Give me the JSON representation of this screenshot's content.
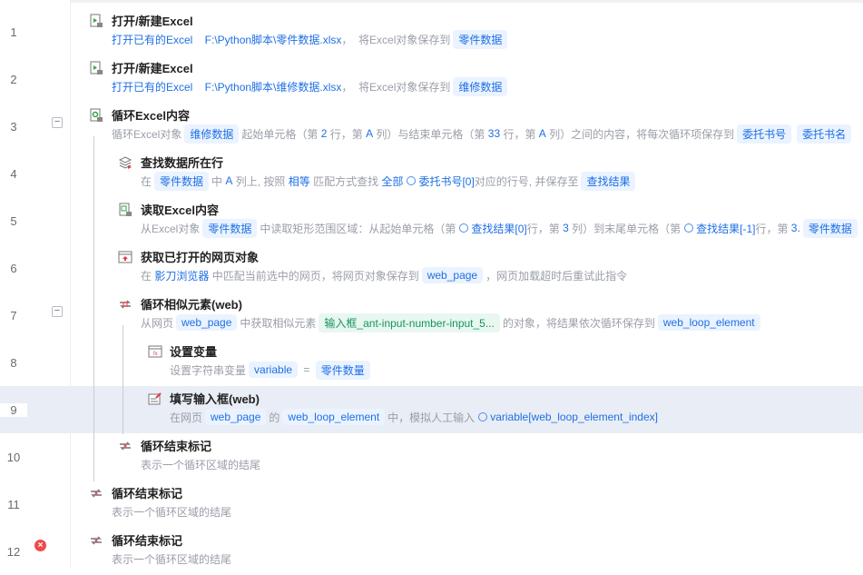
{
  "steps": [
    {
      "num": "1",
      "level": 0,
      "icon": "excel-open-icon",
      "title": "打开/新建Excel",
      "desc": [
        [
          "v",
          "打开已有的Excel    F:\\Python脚本\\零件数据.xlsx"
        ],
        [
          "t",
          "，  将Excel对象保存到"
        ],
        [
          "chip",
          "零件数据"
        ]
      ]
    },
    {
      "num": "2",
      "level": 0,
      "icon": "excel-open-icon",
      "title": "打开/新建Excel",
      "desc": [
        [
          "v",
          "打开已有的Excel    F:\\Python脚本\\维修数据.xlsx"
        ],
        [
          "t",
          "，  将Excel对象保存到"
        ],
        [
          "chip",
          "维修数据"
        ]
      ]
    },
    {
      "num": "3",
      "level": 0,
      "icon": "excel-loop-icon",
      "collapse": "−",
      "title": "循环Excel内容",
      "desc": [
        [
          "t",
          "循环Excel对象"
        ],
        [
          "chip",
          "维修数据"
        ],
        [
          "t",
          "起始单元格（第 "
        ],
        [
          "v",
          "2"
        ],
        [
          "t",
          " 行，第 "
        ],
        [
          "v",
          "A"
        ],
        [
          "t",
          " 列）与结束单元格（第 "
        ],
        [
          "v",
          "33"
        ],
        [
          "t",
          " 行，第 "
        ],
        [
          "v",
          "A"
        ],
        [
          "t",
          " 列）之间的内容，将每次循环项保存到"
        ],
        [
          "chip",
          "委托书号"
        ],
        [
          "chip",
          "委托书名"
        ]
      ]
    },
    {
      "num": "4",
      "level": 1,
      "icon": "find-row-icon",
      "title": "查找数据所在行",
      "desc": [
        [
          "t",
          "在"
        ],
        [
          "chip",
          "零件数据"
        ],
        [
          "t",
          "中 "
        ],
        [
          "v",
          "A"
        ],
        [
          "t",
          " 列上, 按照 "
        ],
        [
          "v",
          "相等"
        ],
        [
          "t",
          " 匹配方式查找 "
        ],
        [
          "v",
          "全部"
        ],
        [
          "vi",
          ""
        ],
        [
          "v",
          "委托书号[0]"
        ],
        [
          "t",
          "对应的行号, 并保存至"
        ],
        [
          "chip",
          "查找结果"
        ]
      ]
    },
    {
      "num": "5",
      "level": 1,
      "icon": "excel-read-icon",
      "title": "读取Excel内容",
      "desc": [
        [
          "t",
          "从Excel对象"
        ],
        [
          "chip",
          "零件数据"
        ],
        [
          "t",
          "中读取矩形范围区域：从起始单元格（第"
        ],
        [
          "vi",
          ""
        ],
        [
          "v",
          "查找结果[0]"
        ],
        [
          "t",
          "行，第 "
        ],
        [
          "v",
          "3"
        ],
        [
          "t",
          " 列）到末尾单元格（第"
        ],
        [
          "vi",
          ""
        ],
        [
          "v",
          "查找结果[-1]"
        ],
        [
          "t",
          "行，第 "
        ],
        [
          "v",
          "3."
        ],
        [
          "chip",
          "零件数据"
        ]
      ]
    },
    {
      "num": "6",
      "level": 1,
      "icon": "browser-page-icon",
      "title": "获取已打开的网页对象",
      "desc": [
        [
          "t",
          "在 "
        ],
        [
          "v",
          "影刀浏览器"
        ],
        [
          "t",
          " 中匹配当前选中的网页，将网页对象保存到"
        ],
        [
          "chip",
          "web_page"
        ],
        [
          "t",
          "，网页加载超时后重试此指令"
        ]
      ]
    },
    {
      "num": "7",
      "level": 1,
      "icon": "loop-icon",
      "collapse": "−",
      "title": "循环相似元素(web)",
      "desc": [
        [
          "t",
          "从网页"
        ],
        [
          "chip",
          "web_page"
        ],
        [
          "t",
          "中获取相似元素"
        ],
        [
          "chipg",
          "输入框_ant-input-number-input_5..."
        ],
        [
          "t",
          "的对象，将结果依次循环保存到"
        ],
        [
          "chip",
          "web_loop_element"
        ]
      ]
    },
    {
      "num": "8",
      "level": 2,
      "icon": "set-variable-icon",
      "title": "设置变量",
      "desc": [
        [
          "t",
          "设置字符串变量"
        ],
        [
          "chip",
          "variable"
        ],
        [
          "t",
          " = "
        ],
        [
          "chip",
          "零件数量"
        ]
      ]
    },
    {
      "num": "9",
      "level": 2,
      "icon": "fill-input-icon",
      "selected": true,
      "title": "填写输入框(web)",
      "desc": [
        [
          "t",
          "在网页"
        ],
        [
          "chip",
          "web_page"
        ],
        [
          "t",
          "的"
        ],
        [
          "chip",
          "web_loop_element"
        ],
        [
          "t",
          "中，模拟人工输入"
        ],
        [
          "vi",
          ""
        ],
        [
          "v",
          "variable[web_loop_element_index]"
        ]
      ]
    },
    {
      "num": "10",
      "level": 1,
      "icon": "loop-end-icon",
      "title": "循环结束标记",
      "desc": [
        [
          "t",
          "表示一个循环区域的结尾"
        ]
      ]
    },
    {
      "num": "11",
      "level": 0,
      "icon": "loop-end-icon",
      "title": "循环结束标记",
      "desc": [
        [
          "t",
          "表示一个循环区域的结尾"
        ]
      ]
    },
    {
      "num": "12",
      "level": 0,
      "icon": "loop-end-icon",
      "error": "×",
      "title": "循环结束标记",
      "desc": [
        [
          "t",
          "表示一个循环区域的结尾"
        ]
      ]
    }
  ],
  "colors": {
    "accent": "#1f6fe5",
    "chip_bg": "#eaf3ff",
    "selected_bg": "#e9edf5",
    "error": "#f04a4a"
  }
}
